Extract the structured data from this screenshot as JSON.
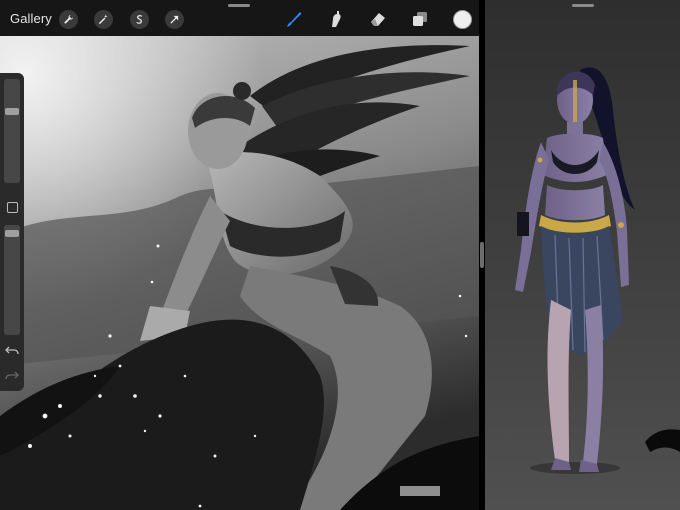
{
  "toolbar": {
    "gallery_label": "Gallery",
    "left_tools": [
      {
        "icon": "wrench-icon"
      },
      {
        "icon": "magic-wand-icon"
      },
      {
        "icon": "selection-s-icon"
      },
      {
        "icon": "arrow-transform-icon"
      }
    ],
    "right_tools": [
      {
        "icon": "brush-icon",
        "active": true
      },
      {
        "icon": "smudge-icon"
      },
      {
        "icon": "eraser-icon"
      },
      {
        "icon": "layers-icon"
      }
    ],
    "current_color": "#efefef",
    "accent_color": "#2f8bff"
  },
  "sidebar": {
    "brush_size_level": 0.7,
    "opacity_level": 0.95
  }
}
